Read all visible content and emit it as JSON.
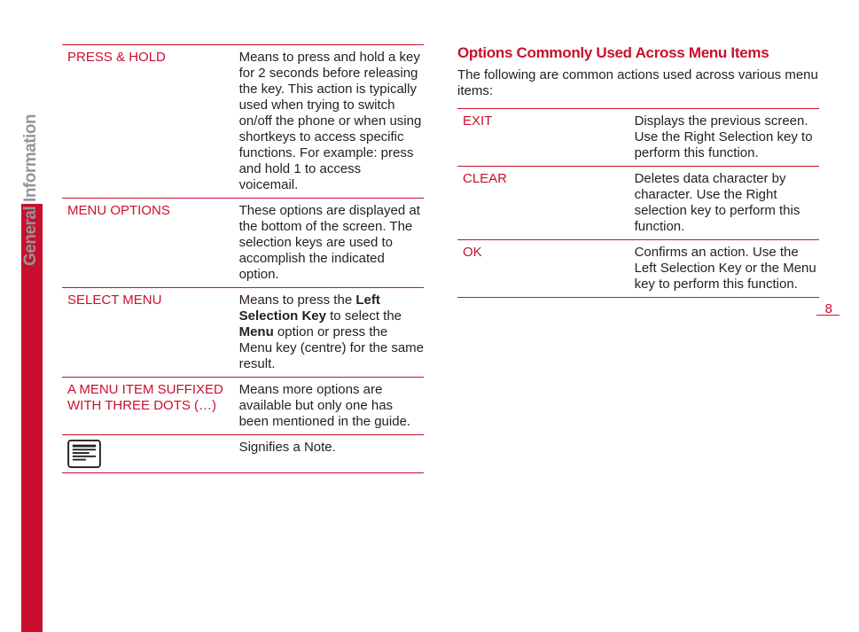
{
  "sideTab": "General Information",
  "pageNumber": "8",
  "left": {
    "rows": [
      {
        "term": "PRESS & HOLD",
        "desc": "Means to press and hold a key for 2 seconds before releasing the key. This action is typically used when trying to switch on/off the phone or when using shortkeys to access specific functions. For example: press and hold 1 to access voicemail."
      },
      {
        "term": "MENU OPTIONS",
        "desc": "These options are displayed at the bottom of the screen. The selection keys are used to accomplish the indicated option."
      },
      {
        "term": "SELECT MENU",
        "desc": "Means to press the <b>Left Selection Key</b> to select the <b>Menu</b> option or press the Menu key (centre) for the same result."
      },
      {
        "term": "A MENU ITEM SUFFIXED WITH THREE DOTS (…)",
        "desc": "Means more options are available but only one has been mentioned in the guide."
      },
      {
        "term": "",
        "desc": "Signifies a Note.",
        "icon": true
      }
    ]
  },
  "right": {
    "heading": "Options Commonly Used Across Menu Items",
    "intro": "The following are common actions used across various menu items:",
    "rows": [
      {
        "term": "EXIT",
        "desc": "Displays the previous screen. Use the Right Selection key to perform this function."
      },
      {
        "term": "CLEAR",
        "desc": "Deletes data character by character. Use the Right selection key to perform this function."
      },
      {
        "term": "OK",
        "desc": "Confirms an action. Use the Left Selection Key or the Menu key to perform this function."
      }
    ]
  }
}
